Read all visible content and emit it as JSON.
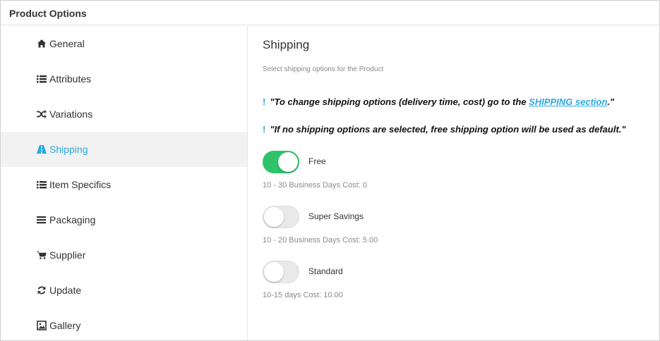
{
  "header": {
    "title": "Product Options"
  },
  "sidebar": {
    "items": [
      {
        "label": "General",
        "icon": "home-icon"
      },
      {
        "label": "Attributes",
        "icon": "list-icon"
      },
      {
        "label": "Variations",
        "icon": "shuffle-icon"
      },
      {
        "label": "Shipping",
        "icon": "road-icon",
        "active": true
      },
      {
        "label": "Item Specifics",
        "icon": "list-icon"
      },
      {
        "label": "Packaging",
        "icon": "bars-icon"
      },
      {
        "label": "Supplier",
        "icon": "cart-icon"
      },
      {
        "label": "Update",
        "icon": "refresh-icon"
      },
      {
        "label": "Gallery",
        "icon": "image-icon"
      }
    ]
  },
  "main": {
    "title": "Shipping",
    "subtitle": "Select shipping options for the Product",
    "notes": [
      {
        "bang": "!",
        "prefix": "\"To change shipping options (delivery time, cost) go to the ",
        "link": "SHIPPING section",
        "suffix": ".\""
      },
      {
        "bang": "!",
        "text": "\"If no shipping options are selected, free shipping option will be used as default.\""
      }
    ],
    "options": [
      {
        "label": "Free",
        "enabled": true,
        "desc": "10 - 30 Business Days Cost: 0"
      },
      {
        "label": "Super Savings",
        "enabled": false,
        "desc": "10 - 20 Business Days Cost: 5.00"
      },
      {
        "label": "Standard",
        "enabled": false,
        "desc": "10-15 days Cost: 10.00"
      }
    ]
  },
  "colors": {
    "accent": "#2ba8e0",
    "toggle_on": "#2ec368",
    "active_bg": "#f2f2f2"
  }
}
